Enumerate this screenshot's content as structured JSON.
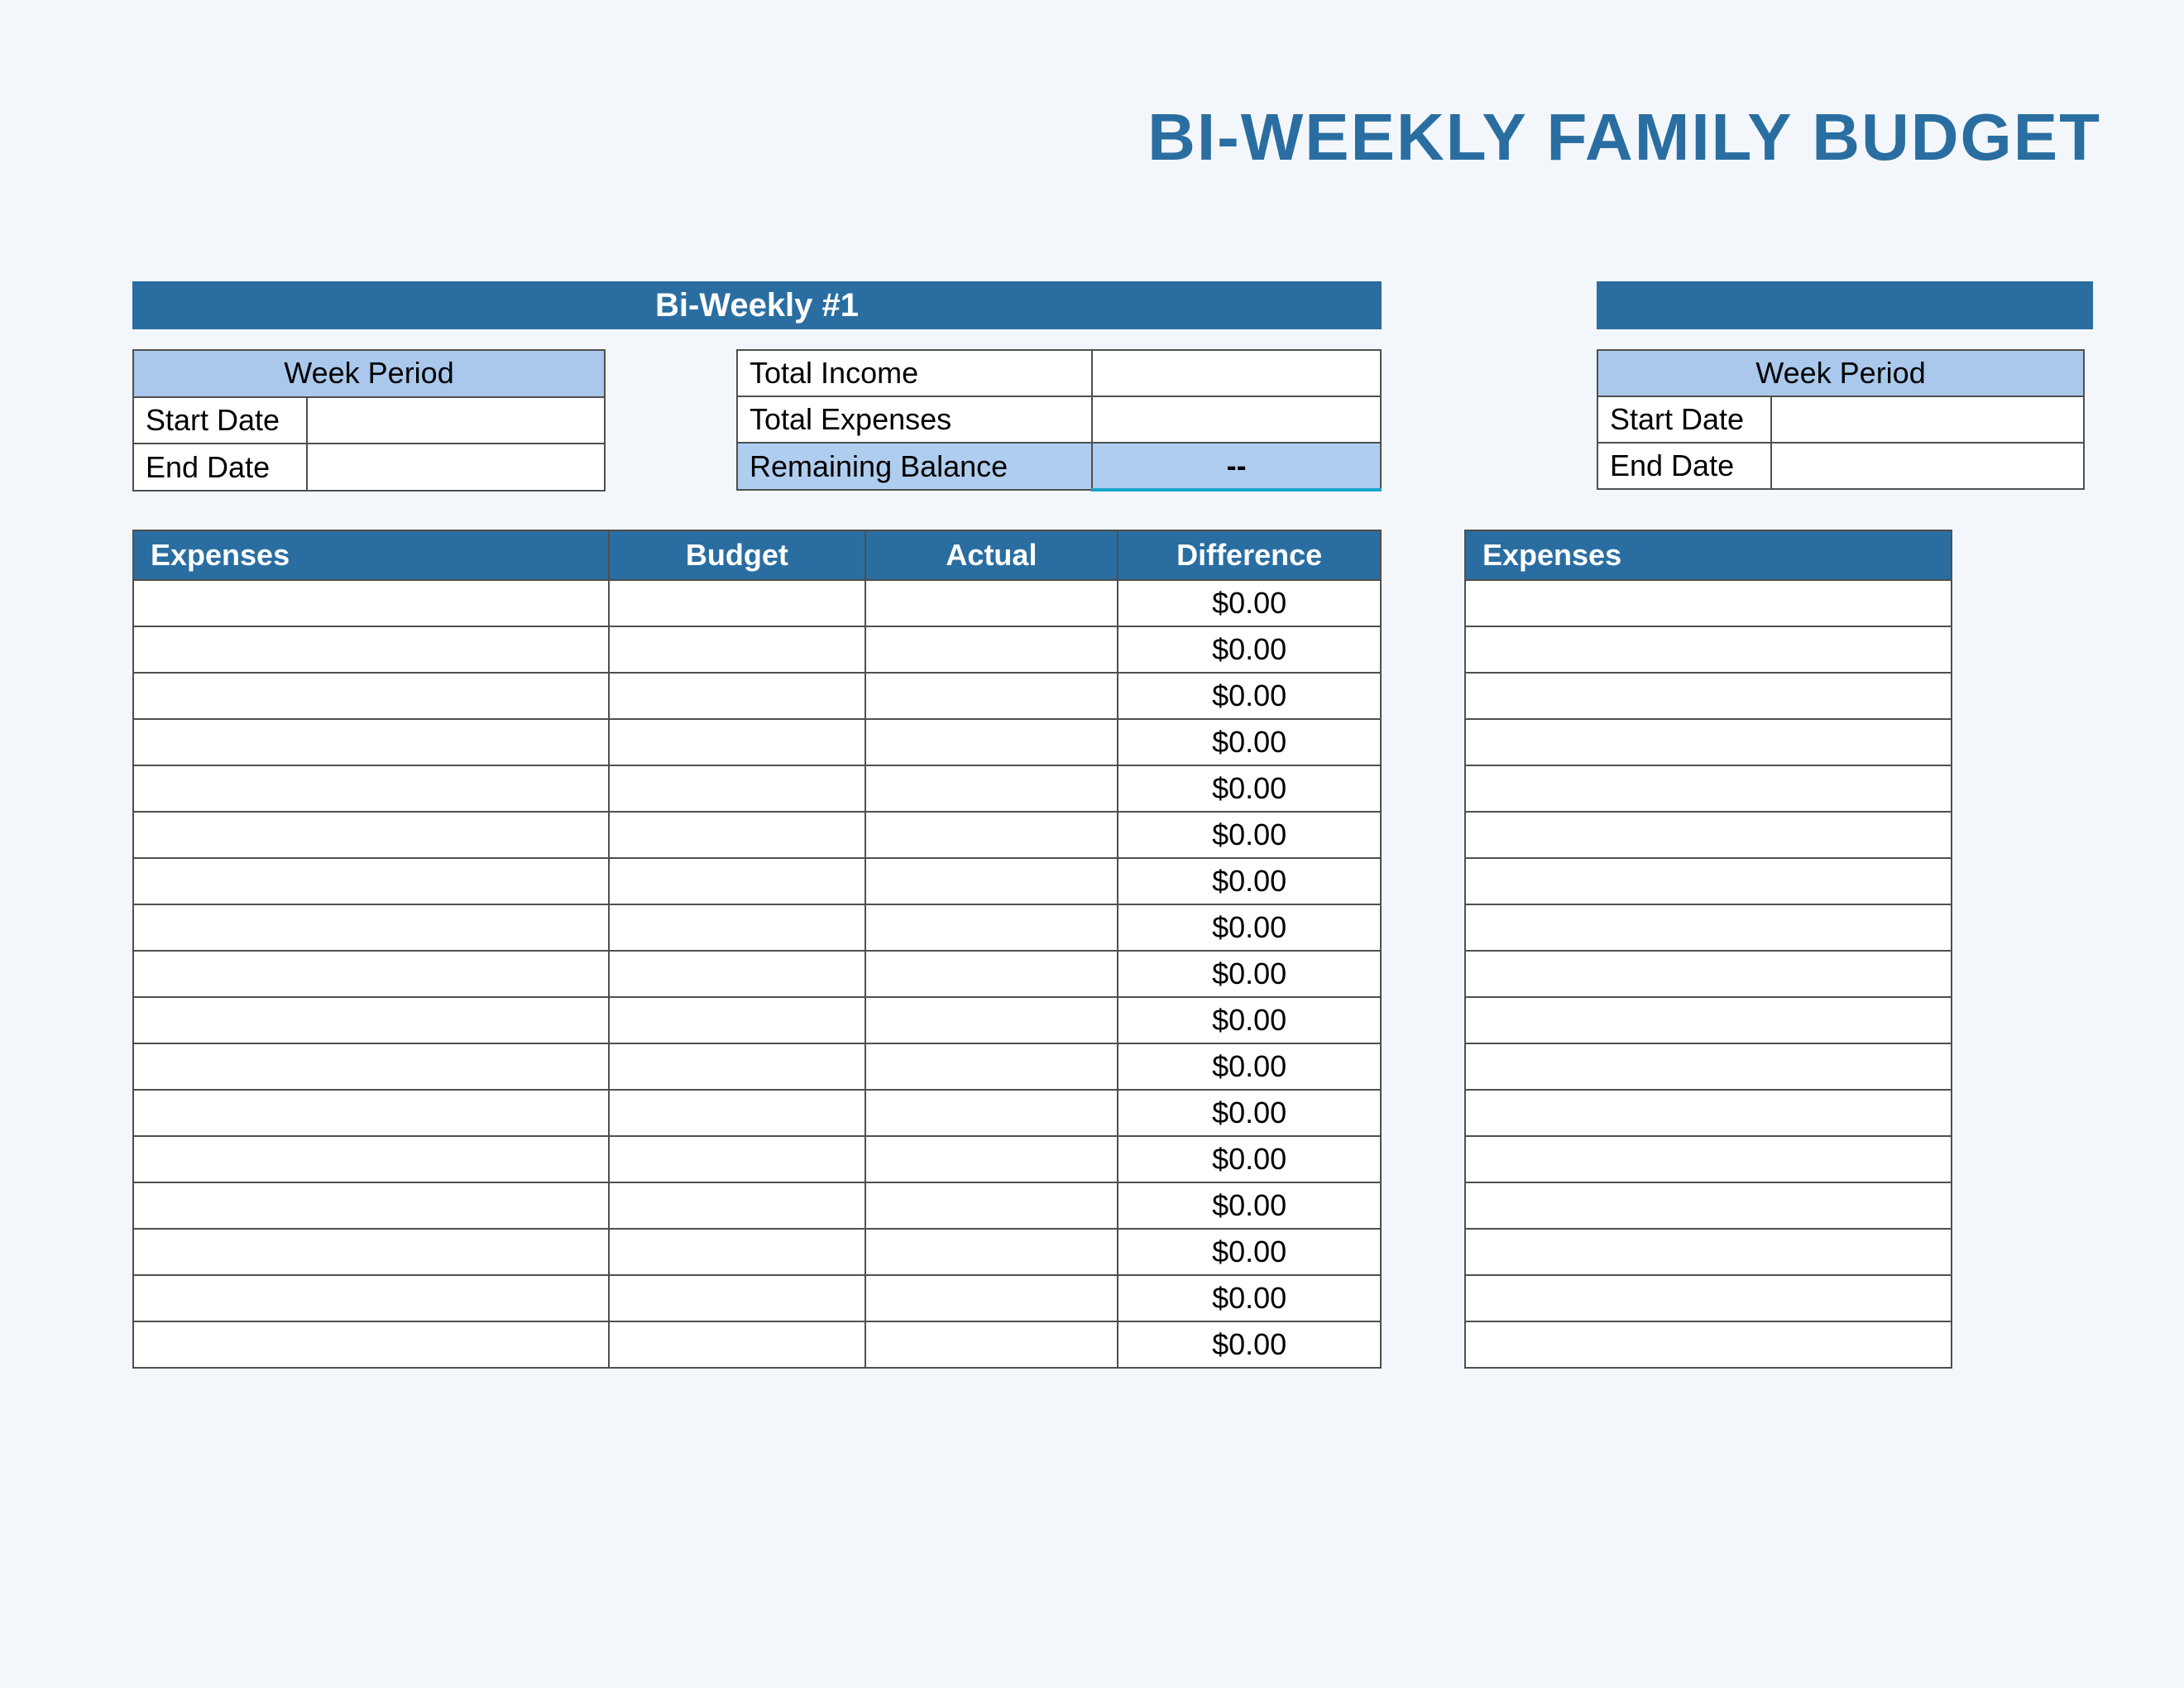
{
  "title": "BI-WEEKLY FAMILY BUDGET",
  "banner_left": "Bi-Weekly #1",
  "week1": {
    "header": "Week Period",
    "start_label": "Start Date",
    "start_value": "",
    "end_label": "End Date",
    "end_value": ""
  },
  "totals": {
    "income_label": "Total Income",
    "income_value": "",
    "expenses_label": "Total Expenses",
    "expenses_value": "",
    "balance_label": "Remaining Balance",
    "balance_value": "--"
  },
  "week2": {
    "header": "Week Period",
    "start_label": "Start Date",
    "start_value": "",
    "end_label": "End Date",
    "end_value": ""
  },
  "expenses_left": {
    "headers": {
      "expenses": "Expenses",
      "budget": "Budget",
      "actual": "Actual",
      "difference": "Difference"
    },
    "rows": [
      {
        "name": "",
        "budget": "",
        "actual": "",
        "diff": "$0.00"
      },
      {
        "name": "",
        "budget": "",
        "actual": "",
        "diff": "$0.00"
      },
      {
        "name": "",
        "budget": "",
        "actual": "",
        "diff": "$0.00"
      },
      {
        "name": "",
        "budget": "",
        "actual": "",
        "diff": "$0.00"
      },
      {
        "name": "",
        "budget": "",
        "actual": "",
        "diff": "$0.00"
      },
      {
        "name": "",
        "budget": "",
        "actual": "",
        "diff": "$0.00"
      },
      {
        "name": "",
        "budget": "",
        "actual": "",
        "diff": "$0.00"
      },
      {
        "name": "",
        "budget": "",
        "actual": "",
        "diff": "$0.00"
      },
      {
        "name": "",
        "budget": "",
        "actual": "",
        "diff": "$0.00"
      },
      {
        "name": "",
        "budget": "",
        "actual": "",
        "diff": "$0.00"
      },
      {
        "name": "",
        "budget": "",
        "actual": "",
        "diff": "$0.00"
      },
      {
        "name": "",
        "budget": "",
        "actual": "",
        "diff": "$0.00"
      },
      {
        "name": "",
        "budget": "",
        "actual": "",
        "diff": "$0.00"
      },
      {
        "name": "",
        "budget": "",
        "actual": "",
        "diff": "$0.00"
      },
      {
        "name": "",
        "budget": "",
        "actual": "",
        "diff": "$0.00"
      },
      {
        "name": "",
        "budget": "",
        "actual": "",
        "diff": "$0.00"
      },
      {
        "name": "",
        "budget": "",
        "actual": "",
        "diff": "$0.00"
      }
    ]
  },
  "expenses_right": {
    "header": "Expenses",
    "row_count": 17
  }
}
